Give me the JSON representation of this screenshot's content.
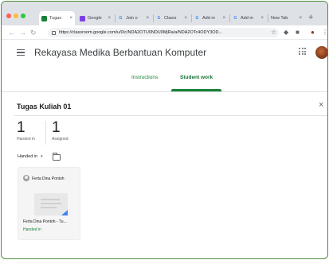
{
  "browser": {
    "tabs": [
      {
        "label": "Tugas",
        "favicon_color": "#188038",
        "favicon_glyph": "",
        "active": true
      },
      {
        "label": "Google",
        "favicon_color": "#7b3fe4",
        "favicon_glyph": "",
        "active": false
      },
      {
        "label": "Join o",
        "favicon_color": "#4285f4",
        "favicon_glyph": "G",
        "active": false
      },
      {
        "label": "Classr",
        "favicon_color": "#4285f4",
        "favicon_glyph": "G",
        "active": false
      },
      {
        "label": "Add m",
        "favicon_color": "#4285f4",
        "favicon_glyph": "G",
        "active": false
      },
      {
        "label": "Add m",
        "favicon_color": "#4285f4",
        "favicon_glyph": "G",
        "active": false
      },
      {
        "label": "New Tab",
        "favicon_color": "",
        "favicon_glyph": "",
        "active": false
      }
    ],
    "tab_close": "×",
    "new_tab": "+",
    "url": "https://classroom.google.com/u/0/c/NDA2OTU0NDU0MjRa/a/NDA2OTc4ODY3OD...",
    "icons": [
      "back-icon",
      "forward-icon",
      "reload-icon",
      "star-icon",
      "extension-icon",
      "menu-icon"
    ]
  },
  "classroom": {
    "course_title": "Rekayasa Medika Berbantuan Komputer",
    "tabs": {
      "instructions": "Instructions",
      "student_work": "Student work"
    },
    "accent": "#188038"
  },
  "assignment": {
    "title": "Tugas Kuliah 01",
    "stats": [
      {
        "value": "1",
        "label": "Handed in"
      },
      {
        "value": "1",
        "label": "Assigned"
      }
    ],
    "filter": {
      "label": "Handed in",
      "caret": "▾"
    },
    "students": [
      {
        "name": "Ferta Dina Pontoh",
        "file": "Ferta Dina Pontoh - Tu...",
        "status": "Handed in"
      }
    ]
  }
}
